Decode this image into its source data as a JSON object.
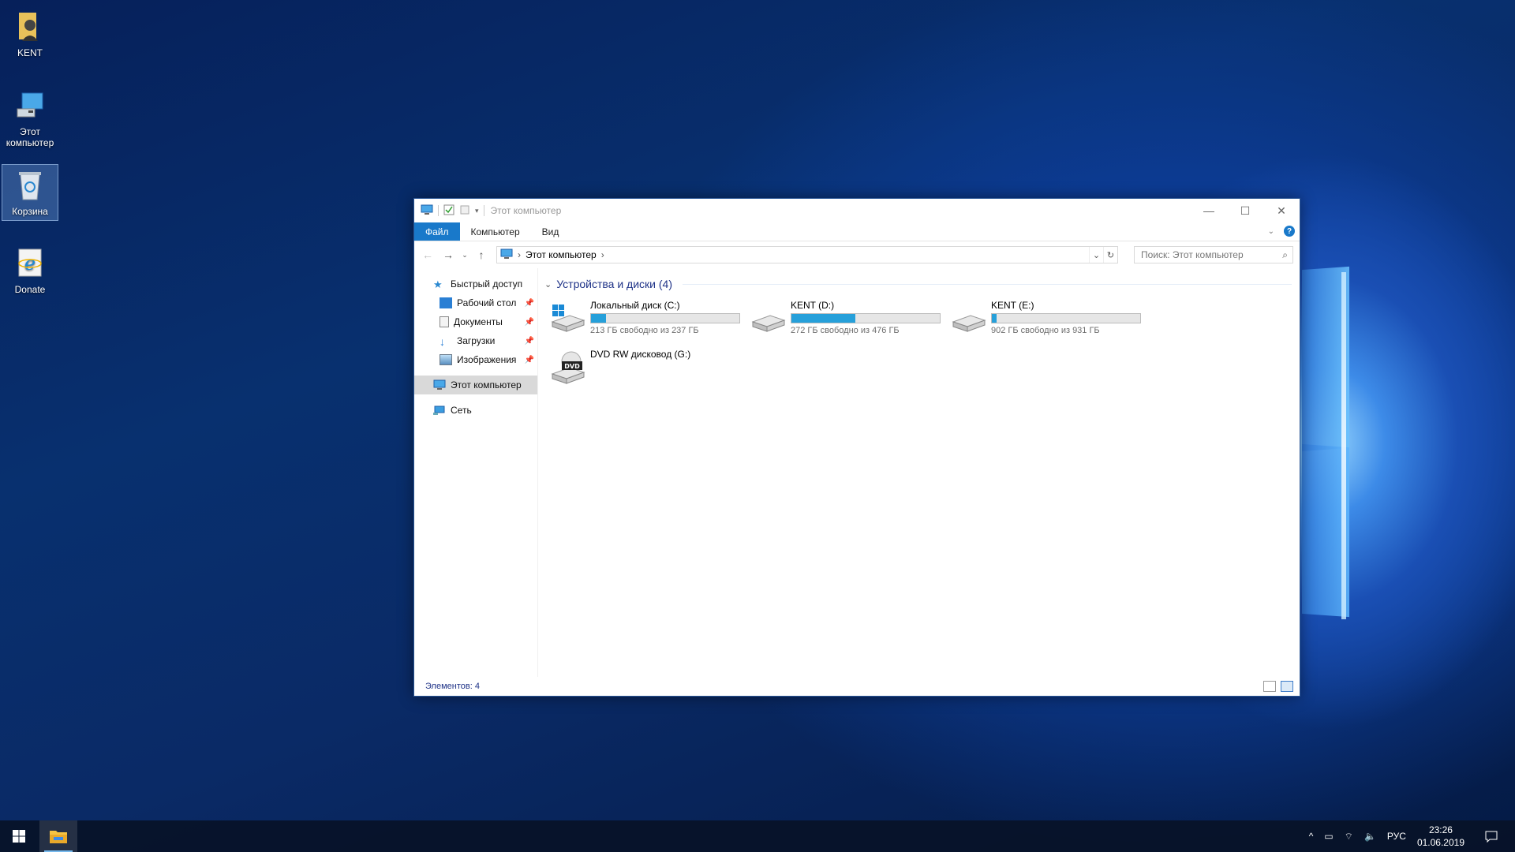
{
  "desktop": {
    "icons": [
      {
        "label": "KENT"
      },
      {
        "label": "Этот компьютер"
      },
      {
        "label": "Корзина"
      },
      {
        "label": "Donate"
      }
    ]
  },
  "window": {
    "title": "Этот компьютер",
    "controls": {
      "minimize": "—",
      "maximize": "☐",
      "close": "✕"
    },
    "ribbon": {
      "tabs": [
        "Файл",
        "Компьютер",
        "Вид"
      ],
      "help": "?"
    },
    "address": {
      "path": "Этот компьютер",
      "separator": "›"
    },
    "search": {
      "placeholder": "Поиск: Этот компьютер"
    },
    "navpane": {
      "quick_access": "Быстрый доступ",
      "pinned": [
        "Рабочий стол",
        "Документы",
        "Загрузки",
        "Изображения"
      ],
      "this_pc": "Этот компьютер",
      "network": "Сеть"
    },
    "group": {
      "title": "Устройства и диски (4)"
    },
    "drives": [
      {
        "name": "Локальный диск (C:)",
        "free": "213 ГБ свободно из 237 ГБ",
        "used_fraction": 0.1,
        "type": "system"
      },
      {
        "name": "KENT (D:)",
        "free": "272 ГБ свободно из 476 ГБ",
        "used_fraction": 0.43,
        "type": "hdd"
      },
      {
        "name": "KENT (E:)",
        "free": "902 ГБ свободно из 931 ГБ",
        "used_fraction": 0.03,
        "type": "hdd"
      },
      {
        "name": "DVD RW дисковод (G:)",
        "type": "dvd"
      }
    ],
    "status": {
      "items": "Элементов: 4"
    }
  },
  "taskbar": {
    "language": "РУС",
    "time": "23:26",
    "date": "01.06.2019"
  },
  "colors": {
    "accent": "#1979ca",
    "bar_fill": "#26a0da",
    "group_title": "#1e3287"
  }
}
